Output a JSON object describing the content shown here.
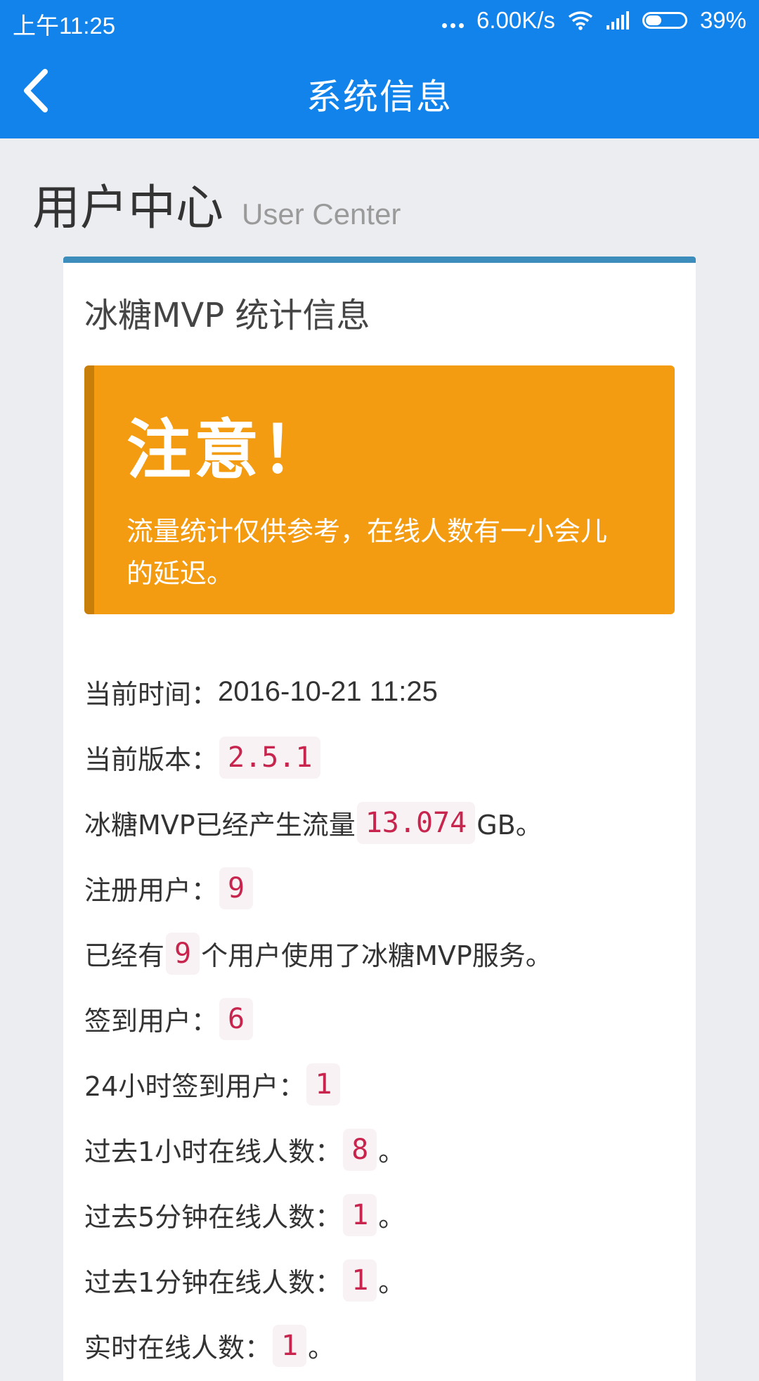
{
  "status_bar": {
    "time": "上午11:25",
    "network_speed": "6.00K/s",
    "battery": "39%",
    "icons": [
      "dots-icon",
      "wifi-icon",
      "signal-icon",
      "battery-icon"
    ]
  },
  "app_bar": {
    "title": "系统信息",
    "back_icon": "chevron-left-icon"
  },
  "section": {
    "title_cn": "用户中心",
    "title_en": "User Center"
  },
  "card": {
    "title": "冰糖MVP 统计信息",
    "accent_color": "#3c8dbc"
  },
  "alert": {
    "title": "注意！",
    "message": "流量统计仅供参考，在线人数有一小会儿的延迟。",
    "color": "#f39c12"
  },
  "stats": {
    "current_time_label": "当前时间：",
    "current_time_value": "2016-10-21 11:25",
    "version_label": "当前版本：",
    "version_value": "2.5.1",
    "traffic_prefix": "冰糖MVP已经产生流量",
    "traffic_value": "13.074",
    "traffic_suffix": "GB。",
    "registered_label": "注册用户：",
    "registered_value": "9",
    "used_prefix": "已经有",
    "used_value": "9",
    "used_suffix": "个用户使用了冰糖MVP服务。",
    "checkin_label": "签到用户：",
    "checkin_value": "6",
    "checkin24_label": "24小时签到用户：",
    "checkin24_value": "1",
    "online1h_label": "过去1小时在线人数：",
    "online1h_value": "8",
    "online5m_label": "过去5分钟在线人数：",
    "online5m_value": "1",
    "online1m_label": "过去1分钟在线人数：",
    "online1m_value": "1",
    "realtime_label": "实时在线人数：",
    "realtime_value": "1",
    "period": "。",
    "code_color": "#c7254e"
  }
}
